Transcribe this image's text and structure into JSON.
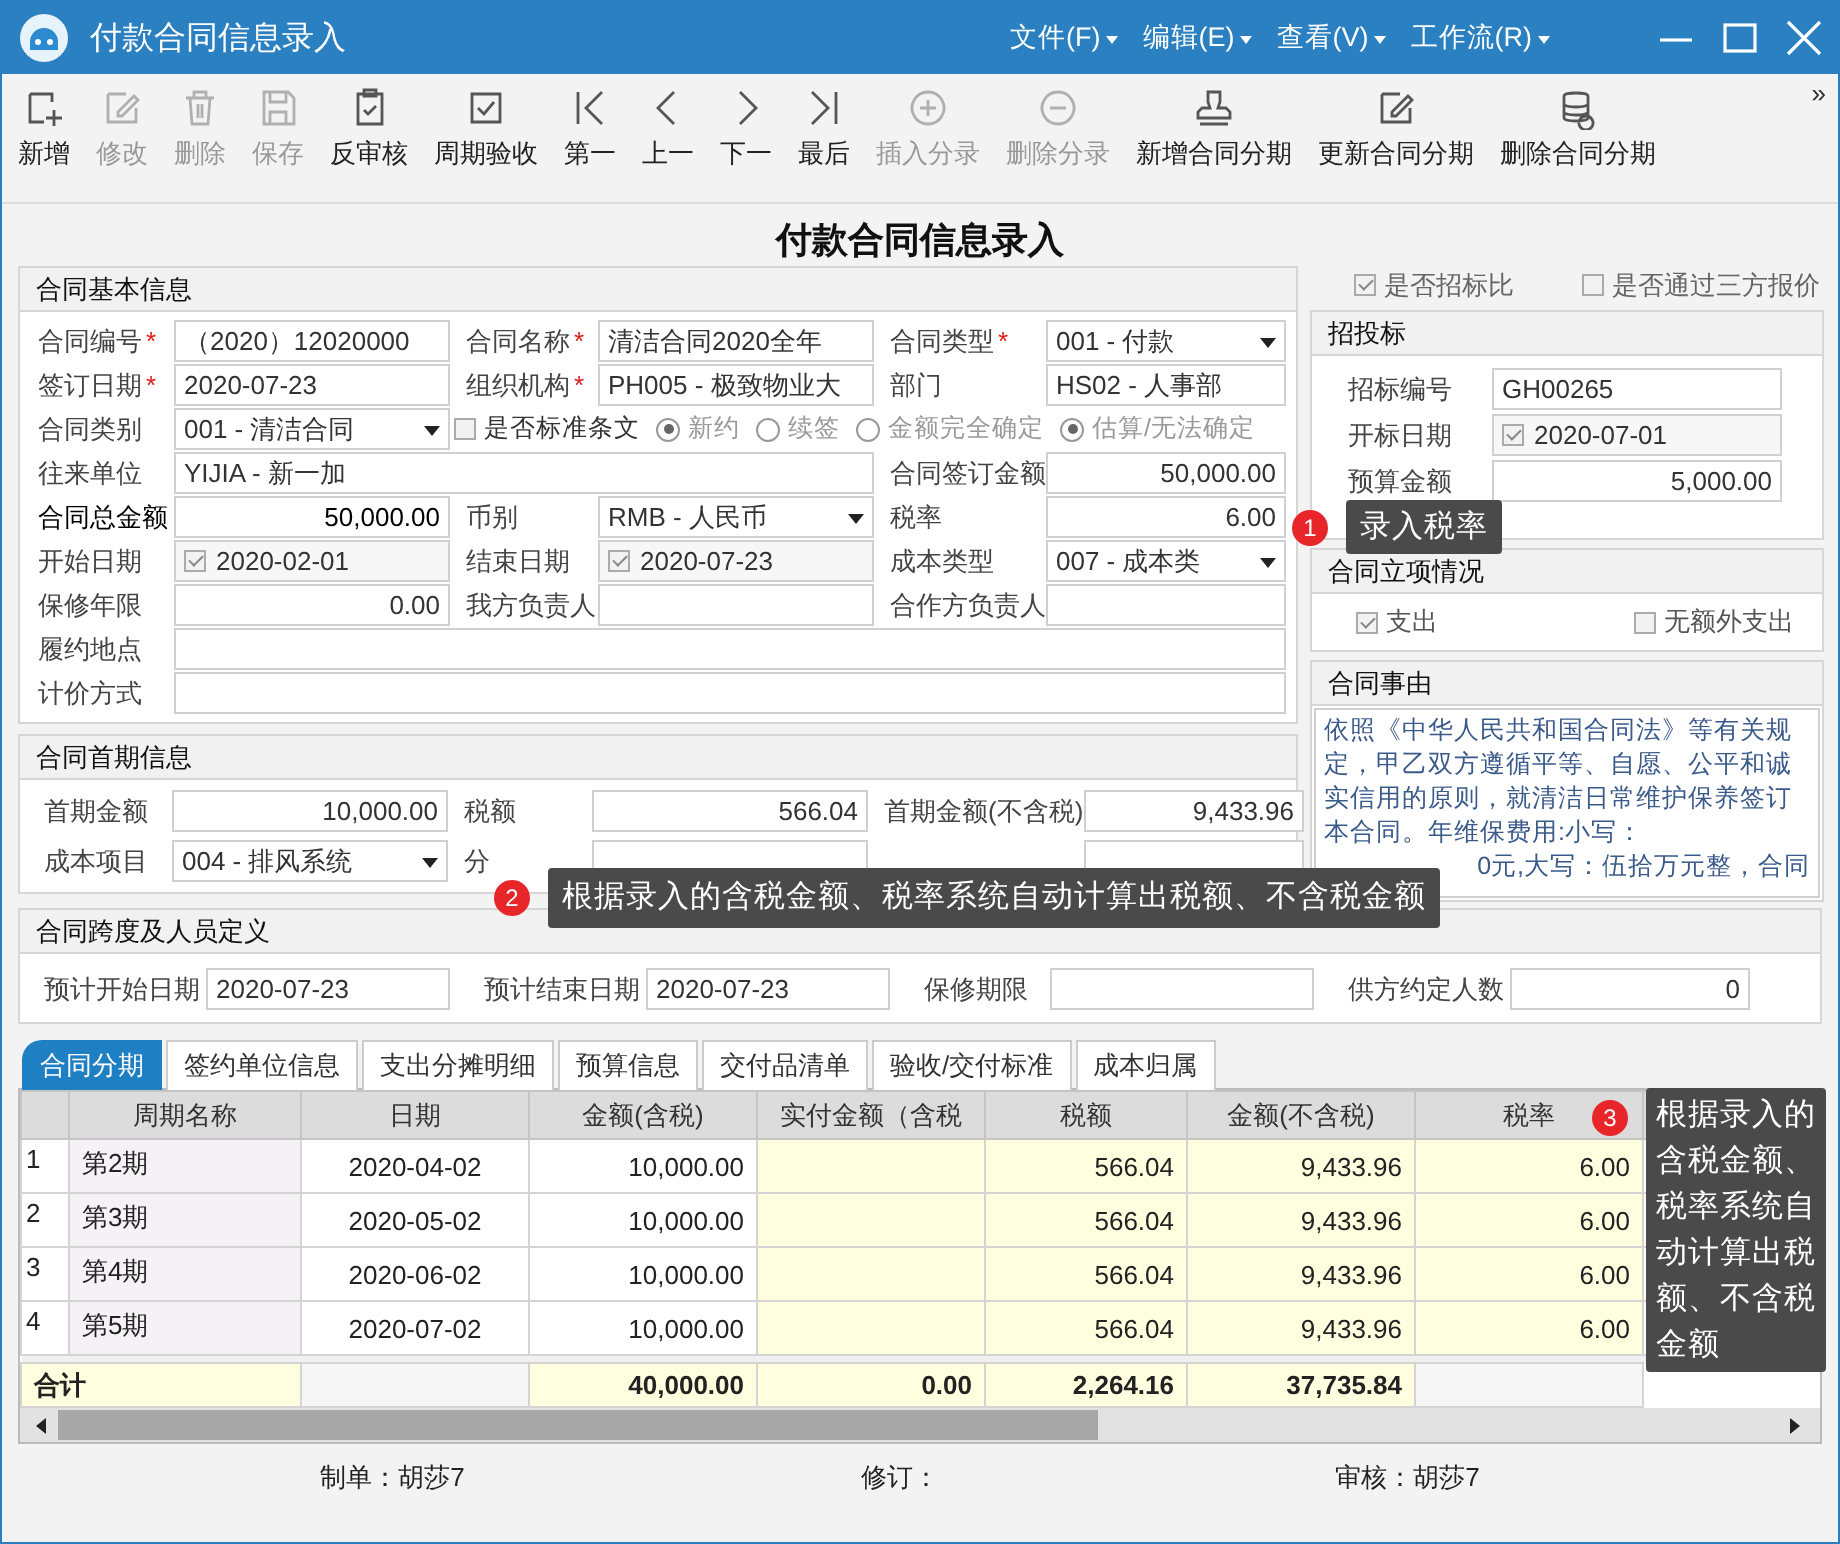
{
  "window": {
    "title": "付款合同信息录入",
    "menus": [
      "文件(F)",
      "编辑(E)",
      "查看(V)",
      "工作流(R)"
    ]
  },
  "toolbar": {
    "items": [
      {
        "label": "新增",
        "disabled": false
      },
      {
        "label": "修改",
        "disabled": true
      },
      {
        "label": "删除",
        "disabled": true
      },
      {
        "label": "保存",
        "disabled": true
      },
      {
        "label": "反审核",
        "disabled": false
      },
      {
        "label": "周期验收",
        "disabled": false
      },
      {
        "label": "第一",
        "disabled": false
      },
      {
        "label": "上一",
        "disabled": false
      },
      {
        "label": "下一",
        "disabled": false
      },
      {
        "label": "最后",
        "disabled": false
      },
      {
        "label": "插入分录",
        "disabled": true
      },
      {
        "label": "删除分录",
        "disabled": true
      },
      {
        "label": "新增合同分期",
        "disabled": false
      },
      {
        "label": "更新合同分期",
        "disabled": false
      },
      {
        "label": "删除合同分期",
        "disabled": false
      }
    ],
    "overflow": "»"
  },
  "page_title": "付款合同信息录入",
  "basic": {
    "title": "合同基本信息",
    "rows": [
      [
        {
          "label": "合同编号",
          "mark": "*",
          "kind": "text",
          "value": "（2020）12020000"
        },
        {
          "label": "合同名称",
          "mark": "*",
          "kind": "text",
          "value": "清洁合同2020全年"
        },
        {
          "label": "合同类型",
          "mark": "*",
          "kind": "select",
          "value": "001 - 付款"
        }
      ],
      [
        {
          "label": "签订日期",
          "mark": "*",
          "kind": "text",
          "value": "2020-07-23"
        },
        {
          "label": "组织机构",
          "mark": "*",
          "kind": "text",
          "value": "PH005 - 极致物业大"
        },
        {
          "label": "部门",
          "kind": "text",
          "value": "HS02 - 人事部"
        }
      ],
      [
        {
          "label": "合同类别",
          "kind": "select",
          "value": "001 - 清洁合同"
        },
        {
          "kind": "options",
          "check": {
            "label": "是否标准条文",
            "checked": false
          },
          "radios": [
            {
              "label": "新约",
              "selected": true
            },
            {
              "label": "续签",
              "selected": false
            }
          ],
          "radios2": [
            {
              "label": "金额完全确定",
              "selected": false
            },
            {
              "label": "估算/无法确定",
              "selected": true
            }
          ]
        }
      ],
      [
        {
          "label": "往来单位",
          "kind": "wide",
          "value": "YIJIA - 新一加"
        },
        {
          "label": "合同签订金额",
          "kind": "number",
          "value": "50,000.00"
        }
      ],
      [
        {
          "label": "合同总金额",
          "kind": "number",
          "bold": true,
          "value": "50,000.00"
        },
        {
          "label": "币别",
          "kind": "select",
          "value": "RMB - 人民币"
        },
        {
          "label": "税率",
          "kind": "number",
          "value": "6.00"
        }
      ],
      [
        {
          "label": "开始日期",
          "kind": "date",
          "checked": true,
          "value": "2020-02-01"
        },
        {
          "label": "结束日期",
          "kind": "date",
          "checked": true,
          "value": "2020-07-23"
        },
        {
          "label": "成本类型",
          "kind": "select",
          "value": "007 - 成本类"
        }
      ],
      [
        {
          "label": "保修年限",
          "kind": "number",
          "value": "0.00"
        },
        {
          "label": "我方负责人",
          "kind": "text"
        },
        {
          "label": "合作方负责人",
          "kind": "text"
        }
      ],
      [
        {
          "label": "履约地点",
          "kind": "full"
        }
      ],
      [
        {
          "label": "计价方式",
          "kind": "full"
        }
      ]
    ]
  },
  "first_period": {
    "title": "合同首期信息",
    "rows": [
      [
        {
          "label": "首期金额",
          "kind": "number",
          "value": "10,000.00"
        },
        {
          "label": "税额",
          "kind": "number",
          "value": "566.04"
        },
        {
          "label": "首期金额(不含税)",
          "kind": "number",
          "value": "9,433.96"
        }
      ],
      [
        {
          "label": "成本项目",
          "kind": "select",
          "value": "004 - 排风系统"
        },
        {
          "label": "分",
          "kind": "text"
        },
        {
          "kind": "text"
        }
      ]
    ]
  },
  "right": {
    "checks": [
      {
        "label": "是否招标比",
        "checked": true
      },
      {
        "label": "是否通过三方报价",
        "checked": false
      }
    ],
    "bidding": {
      "title": "招投标",
      "fields": [
        {
          "label": "招标编号",
          "kind": "text",
          "value": "GH00265"
        },
        {
          "label": "开标日期",
          "kind": "date",
          "checked": true,
          "value": "2020-07-01"
        },
        {
          "label": "预算金额",
          "kind": "number",
          "value": "5,000.00"
        }
      ]
    },
    "approval": {
      "title": "合同立项情况",
      "checks": [
        {
          "label": "支出",
          "checked": true
        },
        {
          "label": "无额外支出",
          "checked": false
        }
      ]
    },
    "reason": {
      "title": "合同事由",
      "text": "依照《中华人民共和国合同法》等有关规定，甲乙双方遵循平等、自愿、公平和诚实信用的原则，就清洁日常维护保养签订本合同。年维保费用:小写：",
      "tail": "0元,大写：伍拾万元整，合同"
    }
  },
  "span": {
    "title": "合同跨度及人员定义",
    "fields": [
      {
        "label": "预计开始日期",
        "kind": "text",
        "value": "2020-07-23"
      },
      {
        "label": "预计结束日期",
        "kind": "text",
        "value": "2020-07-23"
      },
      {
        "label": "保修期限",
        "kind": "text"
      },
      {
        "label": "供方约定人数",
        "kind": "number",
        "value": "0"
      }
    ]
  },
  "tabs": [
    {
      "label": "合同分期",
      "selected": true
    },
    {
      "label": "签约单位信息",
      "selected": false
    },
    {
      "label": "支出分摊明细",
      "selected": false
    },
    {
      "label": "预算信息",
      "selected": false
    },
    {
      "label": "交付品清单",
      "selected": false
    },
    {
      "label": "验收/交付标准",
      "selected": false
    },
    {
      "label": "成本归属",
      "selected": false
    }
  ],
  "table": {
    "columns": [
      {
        "kind": "index"
      },
      {
        "label": "周期名称",
        "kind": "name"
      },
      {
        "label": "日期",
        "kind": "date"
      },
      {
        "label": "金额(含税)",
        "kind": "amount"
      },
      {
        "label": "实付金额（含税",
        "kind": "editable"
      },
      {
        "label": "税额",
        "kind": "editable"
      },
      {
        "label": "金额(不含税)",
        "kind": "editable"
      },
      {
        "label": "税率",
        "kind": "editable"
      }
    ],
    "rows": [
      [
        "1",
        "第2期",
        "2020-04-02",
        "10,000.00",
        null,
        "566.04",
        "9,433.96",
        "6.00"
      ],
      [
        "2",
        "第3期",
        "2020-05-02",
        "10,000.00",
        null,
        "566.04",
        "9,433.96",
        "6.00"
      ],
      [
        "3",
        "第4期",
        "2020-06-02",
        "10,000.00",
        null,
        "566.04",
        "9,433.96",
        "6.00"
      ],
      [
        "4",
        "第5期",
        "2020-07-02",
        "10,000.00",
        null,
        "566.04",
        "9,433.96",
        "6.00"
      ]
    ],
    "total": [
      {
        "value": "合计"
      },
      {
        "kind": "blank"
      },
      {
        "value": "40,000.00"
      },
      {
        "value": "0.00"
      },
      {
        "value": "2,264.16"
      },
      {
        "value": "37,735.84"
      },
      {
        "kind": "blank"
      }
    ]
  },
  "footer": [
    "制单：胡莎7",
    "修订：",
    "审核：胡莎7"
  ],
  "callouts": [
    {
      "number": "1",
      "text": "录入税率"
    },
    {
      "number": "2",
      "text": "根据录入的含税金额、税率系统自动计算出税额、不含税金额"
    },
    {
      "number": "3",
      "text": "根据录入的含税金额、税率系统自动计算出税额、不含税金额"
    }
  ]
}
